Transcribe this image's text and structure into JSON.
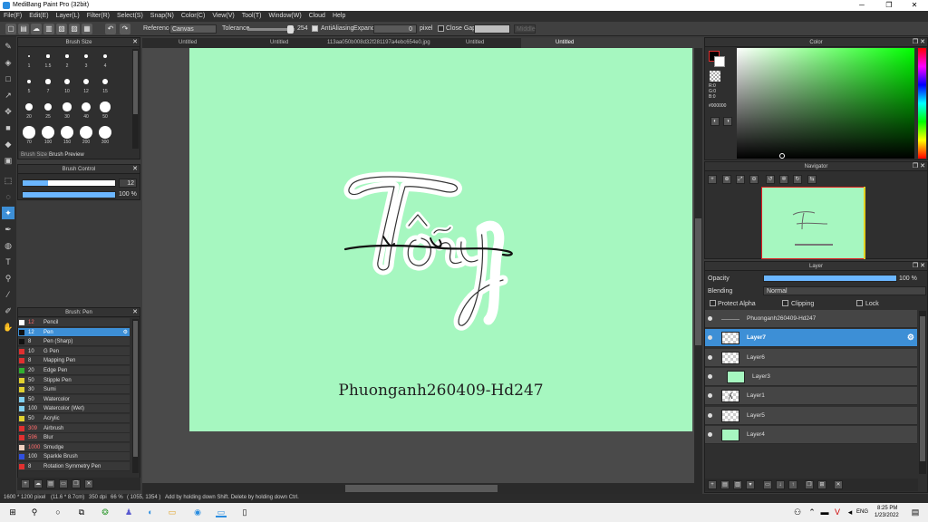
{
  "window": {
    "title": "MediBang Paint Pro (32bit)",
    "min": "─",
    "max": "❐",
    "close": "✕"
  },
  "menu": [
    "File(F)",
    "Edit(E)",
    "Layer(L)",
    "Filter(R)",
    "Select(S)",
    "Snap(N)",
    "Color(C)",
    "View(V)",
    "Tool(T)",
    "Window(W)",
    "Cloud",
    "Help"
  ],
  "options": {
    "reference_label": "Reference",
    "reference_value": "Canvas",
    "tolerance_label": "Tolerance",
    "tolerance_value": "254",
    "antialiasing_label": "AntiAliasing",
    "expand_label": "Expand",
    "expand_value": "0",
    "expand_unit": "pixel",
    "close_gaps_label": "Close Gaps",
    "disabled_value": "Middle"
  },
  "brush_size_panel": {
    "title": "Brush Size",
    "sizes": [
      "1",
      "1.5",
      "2",
      "3",
      "4",
      "5",
      "7",
      "10",
      "12",
      "15",
      "20",
      "25",
      "30",
      "40",
      "50",
      "70",
      "100",
      "150",
      "200",
      "300"
    ],
    "tabs": [
      "Brush Size",
      "Brush Preview"
    ]
  },
  "brush_control": {
    "title": "Brush Control",
    "size_value": "12",
    "size_fill": 0.27,
    "opacity_value": "100 %",
    "opacity_fill": 1.0
  },
  "brush_list": {
    "title": "Brush: Pen",
    "items": [
      {
        "size": "12",
        "name": "Pencil",
        "color": "#ffffff",
        "size_color": "#ff6b6b"
      },
      {
        "size": "12",
        "name": "Pen",
        "color": "#111111",
        "size_color": "#ff6b6b",
        "selected": true
      },
      {
        "size": "8",
        "name": "Pen (Sharp)",
        "color": "#111111",
        "size_color": "#dddddd"
      },
      {
        "size": "10",
        "name": "G Pen",
        "color": "#e03030",
        "size_color": "#dddddd"
      },
      {
        "size": "8",
        "name": "Mapping Pen",
        "color": "#e03030",
        "size_color": "#dddddd"
      },
      {
        "size": "20",
        "name": "Edge Pen",
        "color": "#30b030",
        "size_color": "#dddddd"
      },
      {
        "size": "50",
        "name": "Stipple Pen",
        "color": "#e0d030",
        "size_color": "#dddddd"
      },
      {
        "size": "30",
        "name": "Sumi",
        "color": "#e0d030",
        "size_color": "#dddddd"
      },
      {
        "size": "50",
        "name": "Watercolor",
        "color": "#80d0f0",
        "size_color": "#dddddd"
      },
      {
        "size": "100",
        "name": "Watercolor (Wet)",
        "color": "#80d0f0",
        "size_color": "#dddddd"
      },
      {
        "size": "50",
        "name": "Acrylic",
        "color": "#e0d030",
        "size_color": "#dddddd"
      },
      {
        "size": "309",
        "name": "Airbrush",
        "color": "#e03030",
        "size_color": "#ff6b6b"
      },
      {
        "size": "596",
        "name": "Blur",
        "color": "#e03030",
        "size_color": "#ff6b6b"
      },
      {
        "size": "1000",
        "name": "Smudge",
        "color": "#f0d0c0",
        "size_color": "#ff6b6b"
      },
      {
        "size": "100",
        "name": "Sparkle Brush",
        "color": "#3050e0",
        "size_color": "#dddddd"
      },
      {
        "size": "8",
        "name": "Rotation Symmetry Pen",
        "color": "#e03030",
        "size_color": "#dddddd"
      }
    ]
  },
  "doc_tabs": [
    "Untitled",
    "Untitled",
    "113aa050b008d32f281197a4ebc654e0.jpg",
    "Untitled",
    "Untitled"
  ],
  "canvas": {
    "bg": "#a6f7c0",
    "watermark": "Phuonganh260409-Hd247"
  },
  "color_panel": {
    "title": "Color",
    "r": "R:0",
    "g": "G:0",
    "b": "B:0",
    "hex": "#000000"
  },
  "navigator": {
    "title": "Navigator"
  },
  "layer_panel": {
    "title": "Layer",
    "opacity_label": "Opacity",
    "opacity_value": "100 %",
    "opacity_fill": 1.0,
    "blending_label": "Blending",
    "blending_value": "Normal",
    "protect_alpha": "Protect Alpha",
    "clipping": "Clipping",
    "lock": "Lock",
    "layers": [
      {
        "name": "Phuonganh260409-Hd247",
        "thumb": "text"
      },
      {
        "name": "Layer7",
        "thumb": "blank",
        "selected": true
      },
      {
        "name": "Layer6",
        "thumb": "blank"
      },
      {
        "name": "Layer3",
        "thumb": "green",
        "indent": true
      },
      {
        "name": "Layer1",
        "thumb": "sketch"
      },
      {
        "name": "Layer5",
        "thumb": "blank"
      },
      {
        "name": "Layer4",
        "thumb": "green"
      }
    ]
  },
  "status": {
    "size": "1600 * 1200 pixel",
    "inch": "(11.6 * 8.7cm)",
    "dpi": "350 dpi",
    "zoom": "66 %",
    "coords": "( 1055, 1354 )",
    "hint": "Add by holding down Shift. Delete by holding down Ctrl."
  },
  "taskbar": {
    "time": "8:25 PM",
    "date": "1/23/2022",
    "lang": "ENG"
  }
}
